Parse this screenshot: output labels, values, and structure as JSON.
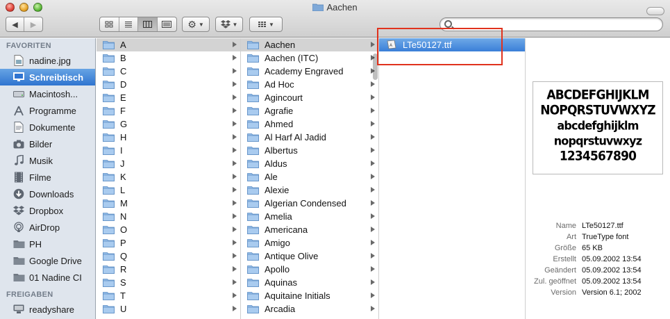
{
  "window": {
    "title": "Aachen"
  },
  "search": {
    "value": "",
    "placeholder": ""
  },
  "sidebar": {
    "favorites_header": "FAVORITEN",
    "favorites": [
      {
        "label": "nadine.jpg",
        "icon": "image-file-icon"
      },
      {
        "label": "Schreibtisch",
        "icon": "desktop-icon",
        "selected": true
      },
      {
        "label": "Macintosh...",
        "icon": "hard-drive-icon"
      },
      {
        "label": "Programme",
        "icon": "applications-icon"
      },
      {
        "label": "Dokumente",
        "icon": "documents-icon"
      },
      {
        "label": "Bilder",
        "icon": "camera-icon"
      },
      {
        "label": "Musik",
        "icon": "music-icon"
      },
      {
        "label": "Filme",
        "icon": "film-icon"
      },
      {
        "label": "Downloads",
        "icon": "downloads-icon"
      },
      {
        "label": "Dropbox",
        "icon": "dropbox-icon"
      },
      {
        "label": "AirDrop",
        "icon": "airdrop-icon"
      },
      {
        "label": "PH",
        "icon": "folder-icon"
      },
      {
        "label": "Google Drive",
        "icon": "folder-icon"
      },
      {
        "label": "01 Nadine CI",
        "icon": "folder-icon"
      }
    ],
    "shared_header": "FREIGABEN",
    "shared": [
      {
        "label": "readyshare",
        "icon": "server-icon"
      }
    ]
  },
  "columns": {
    "letters": [
      "A",
      "B",
      "C",
      "D",
      "E",
      "F",
      "G",
      "H",
      "I",
      "J",
      "K",
      "L",
      "M",
      "N",
      "O",
      "P",
      "Q",
      "R",
      "S",
      "T",
      "U"
    ],
    "fonts": [
      "Aachen",
      "Aachen (ITC)",
      "Academy Engraved",
      "Ad Hoc",
      "Agincourt",
      "Agrafie",
      "Ahmed",
      "Al Harf Al Jadid",
      "Albertus",
      "Aldus",
      "Ale",
      "Alexie",
      "Algerian Condensed",
      "Amelia",
      "Americana",
      "Amigo",
      "Antique Olive",
      "Apollo",
      "Aquinas",
      "Aquitaine Initials",
      "Arcadia"
    ],
    "files": [
      "LTe50127.ttf"
    ]
  },
  "preview": {
    "sample_lines": [
      "ABCDEFGHIJKLM",
      "NOPQRSTUVWXYZ",
      "abcdefghijklm",
      "nopqrstuvwxyz",
      "1234567890"
    ],
    "meta": [
      {
        "key": "Name",
        "value": "LTe50127.ttf"
      },
      {
        "key": "Art",
        "value": "TrueType font"
      },
      {
        "key": "Größe",
        "value": "65 KB"
      },
      {
        "key": "Erstellt",
        "value": "05.09.2002 13:54"
      },
      {
        "key": "Geändert",
        "value": "05.09.2002 13:54"
      },
      {
        "key": "Zul. geöffnet",
        "value": "05.09.2002 13:54"
      },
      {
        "key": "Version",
        "value": "Version 6.1; 2002"
      }
    ]
  },
  "colors": {
    "selection_blue": "#3a7fd8",
    "sidebar_bg": "#dfe5ed",
    "annotation_red": "#e0321d"
  }
}
